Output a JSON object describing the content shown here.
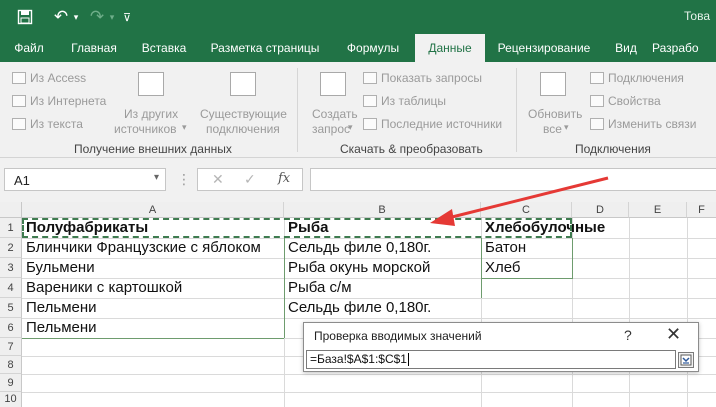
{
  "app": {
    "title_fragment": "Това"
  },
  "quick_access": {
    "undo_label": "↶",
    "redo_label": "↷"
  },
  "tabs": [
    {
      "label": "Файл"
    },
    {
      "label": "Главная"
    },
    {
      "label": "Вставка"
    },
    {
      "label": "Разметка страницы"
    },
    {
      "label": "Формулы"
    },
    {
      "label": "Данные"
    },
    {
      "label": "Рецензирование"
    },
    {
      "label": "Вид"
    },
    {
      "label": "Разрабо"
    }
  ],
  "ribbon": {
    "external": {
      "from_access": "Из Access",
      "from_web": "Из Интернета",
      "from_text": "Из текста",
      "from_other_1": "Из других",
      "from_other_2": "источников",
      "existing_1": "Существующие",
      "existing_2": "подключения",
      "group": "Получение внешних данных"
    },
    "transform": {
      "new_query_1": "Создать",
      "new_query_2": "запрос",
      "show_queries": "Показать запросы",
      "from_table": "Из таблицы",
      "recent_sources": "Последние источники",
      "group": "Скачать & преобразовать"
    },
    "connections": {
      "refresh_1": "Обновить",
      "refresh_2": "все",
      "connections": "Подключения",
      "properties": "Свойства",
      "edit_links": "Изменить связи",
      "group": "Подключения"
    }
  },
  "formula_bar": {
    "name_box": "A1",
    "fx": "fx",
    "cancel": "✕",
    "enter": "✓"
  },
  "grid": {
    "columns": [
      "A",
      "B",
      "C",
      "D",
      "E",
      "F"
    ],
    "rows": [
      "1",
      "2",
      "3",
      "4",
      "5",
      "6",
      "7",
      "8",
      "9",
      "10"
    ],
    "cells": {
      "A1": "Полуфабрикаты",
      "B1": "Рыба",
      "C1": "Хлебобулочные",
      "A2": "Блинчики Французские с яблоком",
      "B2": "Сельдь филе 0,180г.",
      "C2": "Батон",
      "A3": "Бульмени",
      "B3": "Рыба окунь морской",
      "C3": "Хлеб",
      "A4": "Вареники с картошкой",
      "B4": "Рыба с/м",
      "A5": "Пельмени",
      "B5": "Сельдь филе 0,180г.",
      "A6": "Пельмени"
    }
  },
  "dialog": {
    "title": "Проверка вводимых значений",
    "help": "?",
    "close": "✕",
    "value": "=База!$A$1:$C$1"
  },
  "colors": {
    "excel_green": "#217346",
    "arrow_red": "#e53935",
    "marquee": "#3e7b4f"
  }
}
